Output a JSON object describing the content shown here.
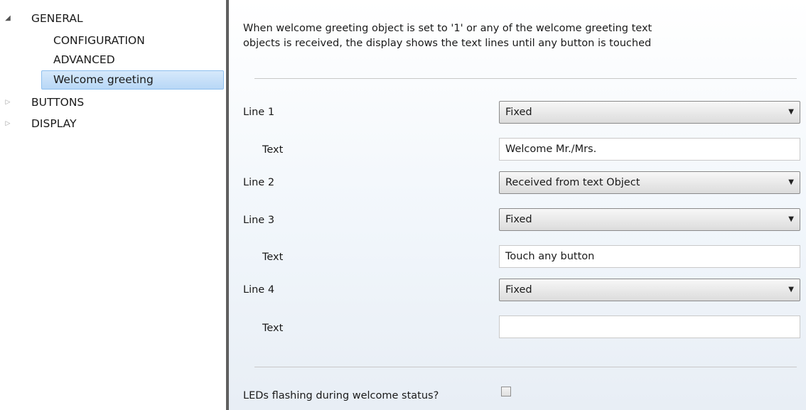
{
  "tree": {
    "general": {
      "label": "GENERAL",
      "toggle": "◢"
    },
    "configuration": {
      "label": "CONFIGURATION"
    },
    "advanced": {
      "label": "ADVANCED"
    },
    "welcome_greeting": {
      "label": "Welcome greeting"
    },
    "buttons": {
      "label": "BUTTONS",
      "toggle": "▷"
    },
    "display": {
      "label": "DISPLAY",
      "toggle": "▷"
    }
  },
  "panel": {
    "description_line1": "When welcome greeting object is set to '1' or any of the welcome greeting text",
    "description_line2": "objects is received, the display shows the text lines until any button is touched",
    "line1": {
      "label": "Line 1",
      "value": "Fixed"
    },
    "line1_text": {
      "label": "Text",
      "value": "Welcome Mr./Mrs."
    },
    "line2": {
      "label": "Line 2",
      "value": "Received from text Object"
    },
    "line3": {
      "label": "Line 3",
      "value": "Fixed"
    },
    "line3_text": {
      "label": "Text",
      "value": "Touch any button"
    },
    "line4": {
      "label": "Line 4",
      "value": "Fixed"
    },
    "line4_text": {
      "label": "Text",
      "value": ""
    },
    "leds_flashing": {
      "label": "LEDs flashing during welcome status?",
      "checked": false
    }
  },
  "icons": {
    "dropdown_arrow": "▼"
  },
  "colors": {
    "selection_fill": "#c4dff8",
    "selection_border": "#8ec0ee",
    "splitter": "#5f5f5f"
  }
}
